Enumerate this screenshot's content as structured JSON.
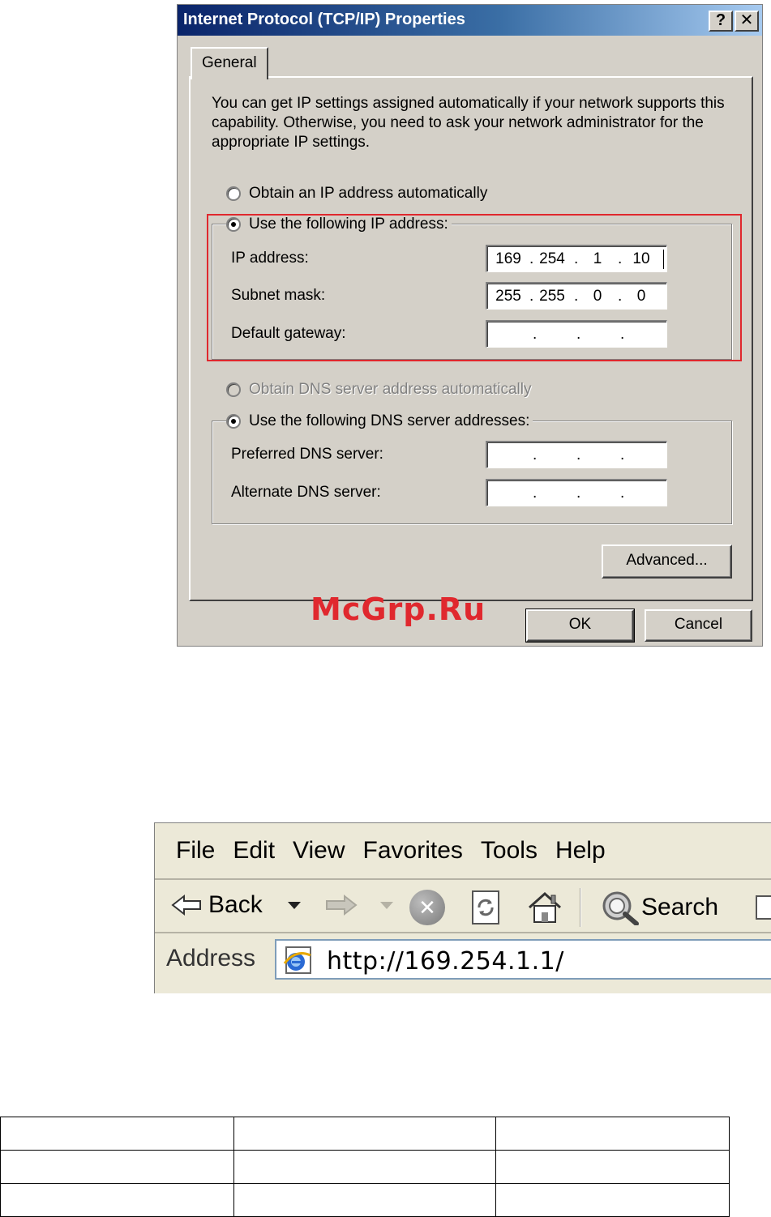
{
  "dialog": {
    "title": "Internet Protocol (TCP/IP) Properties",
    "help_button": "?",
    "close_button": "✕",
    "tab_general": "General",
    "description": "You can get IP settings assigned automatically if your network supports this capability. Otherwise, you need to ask your network administrator for the appropriate IP settings.",
    "radio_auto_ip": "Obtain an IP address automatically",
    "radio_manual_ip": "Use the following IP address:",
    "ip_label": "IP address:",
    "ip_octets": [
      "169",
      "254",
      "1",
      "10"
    ],
    "subnet_label": "Subnet mask:",
    "subnet_octets": [
      "255",
      "255",
      "0",
      "0"
    ],
    "gateway_label": "Default gateway:",
    "radio_auto_dns": "Obtain DNS server address automatically",
    "radio_manual_dns": "Use the following DNS server addresses:",
    "preferred_dns_label": "Preferred DNS server:",
    "alternate_dns_label": "Alternate DNS server:",
    "advanced_button": "Advanced...",
    "ok_button": "OK",
    "cancel_button": "Cancel",
    "selected_ip_mode": "manual",
    "selected_dns_mode": "manual",
    "highlight_color": "#e0282e"
  },
  "watermark": "McGrp.Ru",
  "browser": {
    "menu": [
      "File",
      "Edit",
      "View",
      "Favorites",
      "Tools",
      "Help"
    ],
    "back_label": "Back",
    "search_label": "Search",
    "address_label": "Address",
    "address_value": "http://169.254.1.1/",
    "icons": [
      "back-arrow-icon",
      "dropdown-arrow-icon",
      "forward-arrow-icon",
      "stop-icon",
      "refresh-icon",
      "home-icon",
      "search-icon",
      "ie-page-icon"
    ]
  },
  "table": {
    "rows": 3,
    "columns": 3
  }
}
